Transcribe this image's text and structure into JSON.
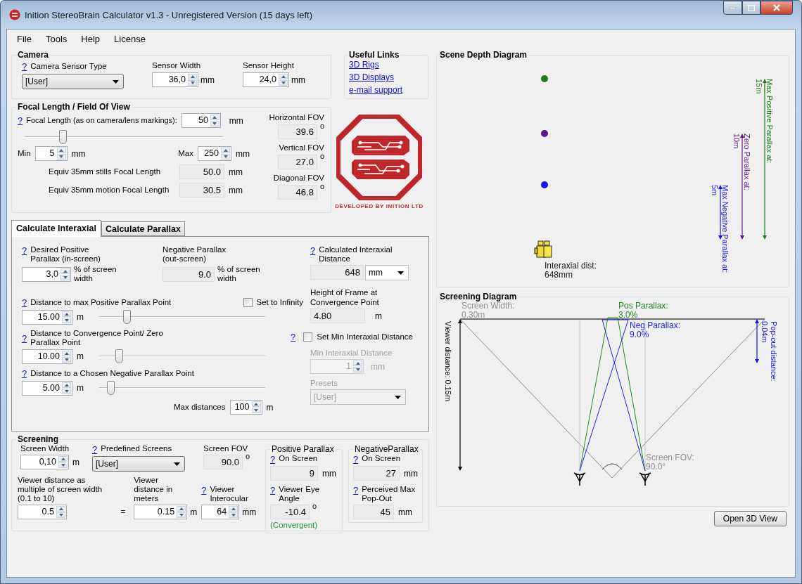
{
  "window": {
    "title": "Inition StereoBrain Calculator v1.3 - Unregistered Version (15 days left)"
  },
  "menu": [
    "File",
    "Tools",
    "Help",
    "License"
  ],
  "camera": {
    "title": "Camera",
    "sensor_type": {
      "help": "?",
      "label": "Camera Sensor Type",
      "value": "[User]"
    },
    "sensor_width": {
      "label": "Sensor Width",
      "value": "36,0",
      "unit": "mm"
    },
    "sensor_height": {
      "label": "Sensor Height",
      "value": "24,0",
      "unit": "mm"
    }
  },
  "useful_links": {
    "title": "Useful Links",
    "links": [
      "3D Rigs",
      "3D Displays",
      "e-mail support"
    ]
  },
  "focal": {
    "title": "Focal Length / Field Of View",
    "focal_length": {
      "help": "?",
      "label": "Focal Length (as on camera/lens markings):",
      "value": "50",
      "unit": "mm"
    },
    "slider": {
      "level": 0.18
    },
    "min": {
      "label": "Min",
      "value": "5",
      "unit": "mm"
    },
    "max": {
      "label": "Max",
      "value": "250",
      "unit": "mm"
    },
    "equivalents": [
      {
        "label": "Equiv 35mm stills Focal Length",
        "value": "50.0",
        "unit": "mm"
      },
      {
        "label": "Equiv 35mm motion Focal Length",
        "value": "30.5",
        "unit": "mm"
      }
    ],
    "fov": [
      {
        "label": "Horizontal FOV",
        "value": "39.6",
        "unit": "o"
      },
      {
        "label": "Vertical FOV",
        "value": "27.0",
        "unit": "o"
      },
      {
        "label": "Diagonal FOV",
        "value": "46.8",
        "unit": "o"
      }
    ]
  },
  "logo": {
    "caption": "DEVELOPED BY INITION LTD"
  },
  "tabs": [
    {
      "label": "Calculate Interaxial",
      "selected": true
    },
    {
      "label": "Calculate Parallax",
      "selected": false
    }
  ],
  "interaxial": {
    "positive_parallax": {
      "help": "?",
      "label": "Desired Positive Parallax (in-screen)",
      "value": "3,0",
      "unit": "% of screen width"
    },
    "negative_parallax": {
      "label": "Negative Parallax (out-screen)",
      "value": "9.0",
      "unit": "% of screen width"
    },
    "distances": [
      {
        "help": "?",
        "label": "Distance to max Positive Parallax Point",
        "value": "15.00",
        "unit": "m",
        "level": 0.15
      },
      {
        "help": "?",
        "label": "Distance to Convergence Point/ Zero Parallax Point",
        "value": "10.00",
        "unit": "m",
        "level": 0.1
      },
      {
        "help": "?",
        "label": "Distance to a Chosen Negative Parallax Point",
        "value": "5.00",
        "unit": "m",
        "level": 0.05
      }
    ],
    "set_to_infinity": {
      "label": "Set to Infinity",
      "checked": false
    },
    "max_distances": {
      "label": "Max distances",
      "value": "100",
      "unit": "m"
    },
    "calculated": {
      "help": "?",
      "label": "Calculated Interaxial Distance",
      "value": "648",
      "unit": "mm"
    },
    "frame_height": {
      "label": "Height of Frame at Convergence Point",
      "value": "4.80",
      "unit": "m"
    },
    "set_min": {
      "help": "?",
      "label": "Set Min Interaxial Distance",
      "checked": false
    },
    "min_interaxial": {
      "label": "Min Interaxial Distance",
      "value": "1",
      "unit": "mm",
      "disabled": true
    },
    "presets": {
      "label": "Presets",
      "value": "[User]",
      "disabled": true
    }
  },
  "screening": {
    "title": "Screening",
    "screen_width": {
      "label": "Screen Width",
      "value": "0,10",
      "unit": "m"
    },
    "predefined": {
      "help": "?",
      "label": "Predefined Screens",
      "value": "[User]"
    },
    "screen_fov": {
      "label": "Screen FOV",
      "value": "90.0",
      "unit": "o"
    },
    "viewer_multiple": {
      "label": "Viewer distance as multiple of screen width (0.1 to 10)",
      "value": "0.5"
    },
    "equals": "=",
    "viewer_meters": {
      "label": "Viewer distance in meters",
      "value": "0.15",
      "unit": "m"
    },
    "interocular": {
      "help": "?",
      "label": "Viewer Interocular",
      "value": "64",
      "unit": "mm"
    },
    "positive": {
      "title": "Positive Parallax",
      "on_screen": {
        "help": "?",
        "label": "On Screen",
        "value": "9",
        "unit": "mm"
      },
      "second": {
        "help": "?",
        "label": "Viewer Eye Angle",
        "value": "-10.4",
        "unit": "o",
        "note": "(Convergent)"
      }
    },
    "negative": {
      "title": "NegativeParallax",
      "on_screen": {
        "help": "?",
        "label": "On Screen",
        "value": "27",
        "unit": "mm"
      },
      "second": {
        "help": "?",
        "label": "Perceived Max Pop-Out",
        "value": "45",
        "unit": "mm"
      }
    }
  },
  "scene_depth": {
    "title": "Scene Depth Diagram",
    "markers": [
      {
        "label": "Max Positive Parallax at:",
        "value": "15m",
        "color": "#1e7a1e"
      },
      {
        "label": "Zero Parallax at:",
        "value": "10m",
        "color": "#5a1a8a"
      },
      {
        "label": "Max Negative Parallax at:",
        "value": "5m",
        "color": "#1414f0"
      }
    ],
    "camera_label": "Interaxial dist:",
    "camera_value": "648mm"
  },
  "screening_diagram": {
    "title": "Screening Diagram",
    "screen_width_label": "Screen Width:",
    "screen_width_value": "0.30m",
    "pos_label": "Pos Parallax:",
    "pos_value": "3.0%",
    "neg_label": "Neg Parallax:",
    "neg_value": "9.0%",
    "popout_label": "Pop-out distance:",
    "popout_value": "0.04m",
    "viewer_distance": "Viewer distance: 0.15m",
    "fov_label": "Screen FOV:",
    "fov_value": "90.0°"
  },
  "open_3d_button": "Open 3D View"
}
